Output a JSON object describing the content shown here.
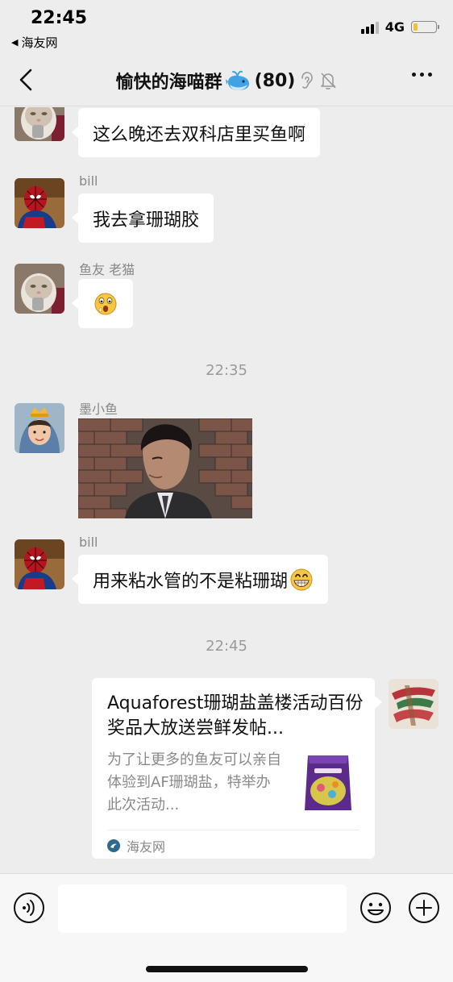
{
  "status_bar": {
    "time": "22:45",
    "back_app": "海友网",
    "network": "4G",
    "battery_level": 0.2,
    "icons": [
      "signal-icon",
      "battery-icon"
    ]
  },
  "nav": {
    "title": "愉快的海喵群",
    "member_count": "(80)",
    "icons": [
      "back-chevron-icon",
      "whale-emoji-icon",
      "ear-icon",
      "mute-bell-icon",
      "more-icon"
    ]
  },
  "messages": [
    {
      "sender": "",
      "text": "这么晚还去双科店里买鱼啊"
    },
    {
      "sender": "bill",
      "text": "我去拿珊瑚胶"
    },
    {
      "sender": "鱼友  老猫",
      "emoji": "astonished-face-icon"
    },
    {
      "sender": "墨小鱼",
      "image": "man-in-suit-photo"
    },
    {
      "sender": "bill",
      "text": "用来粘水管的不是粘珊瑚",
      "emoji": "grinning-face-icon"
    }
  ],
  "timestamps": [
    "22:35",
    "22:45"
  ],
  "link_card": {
    "title": "Aquaforest珊瑚盐盖楼活动百份奖品大放送尝鲜发帖...",
    "description": "为了让更多的鱼友可以亲自体验到AF珊瑚盐，特举办此次活动...",
    "source": "海友网"
  },
  "input_bar": {
    "placeholder": "",
    "icons": [
      "voice-icon",
      "emoji-icon",
      "plus-icon"
    ]
  }
}
